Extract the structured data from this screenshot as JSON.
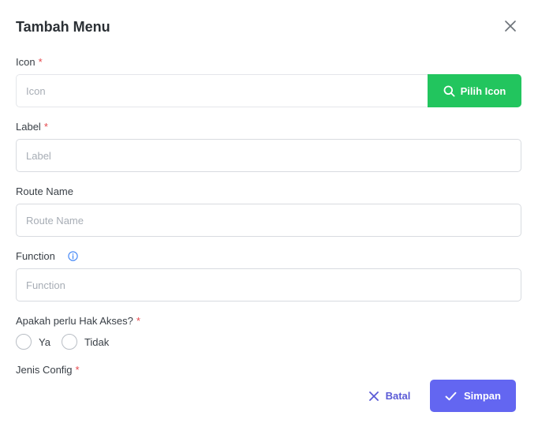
{
  "modal": {
    "title": "Tambah Menu"
  },
  "form": {
    "icon": {
      "label": "Icon",
      "required_mark": "*",
      "placeholder": "Icon",
      "value": "",
      "button_label": "Pilih Icon"
    },
    "label": {
      "label": "Label",
      "required_mark": "*",
      "placeholder": "Label",
      "value": ""
    },
    "route_name": {
      "label": "Route Name",
      "placeholder": "Route Name",
      "value": ""
    },
    "function": {
      "label": "Function",
      "placeholder": "Function",
      "value": ""
    },
    "hak_akses": {
      "label": "Apakah perlu Hak Akses?",
      "required_mark": "*",
      "options": [
        "Ya",
        "Tidak"
      ],
      "selected": null
    },
    "jenis_config": {
      "label": "Jenis Config",
      "required_mark": "*"
    }
  },
  "footer": {
    "cancel_label": "Batal",
    "save_label": "Simpan"
  },
  "colors": {
    "primary": "#6366f1",
    "success": "#22c55e",
    "required": "#e5484d",
    "info": "#3b82f6"
  },
  "icons": {
    "close": "close-icon",
    "search": "search-icon",
    "info": "info-icon",
    "cancel": "x-icon",
    "save": "check-icon"
  }
}
